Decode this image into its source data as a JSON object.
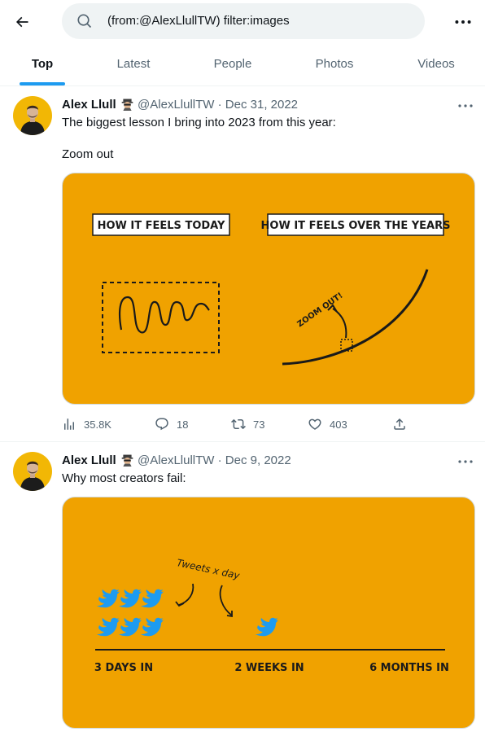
{
  "search": {
    "query": "(from:@AlexLlullTW) filter:images"
  },
  "tabs": [
    {
      "label": "Top",
      "active": true
    },
    {
      "label": "Latest",
      "active": false
    },
    {
      "label": "People",
      "active": false
    },
    {
      "label": "Photos",
      "active": false
    },
    {
      "label": "Videos",
      "active": false
    }
  ],
  "tweets": [
    {
      "name": "Alex Llull",
      "name_emoji": "spy-emoji",
      "handle": "@AlexLlullTW",
      "separator": "·",
      "date": "Dec 31, 2022",
      "text_lines": [
        "The biggest lesson I bring into 2023 from this year:",
        "Zoom out"
      ],
      "media": {
        "left_label": "HOW IT FEELS TODAY",
        "right_label": "HOW IT FEELS OVER THE YEARS",
        "annotation": "ZOOM OUT!"
      },
      "stats": {
        "views": "35.8K",
        "replies": "18",
        "retweets": "73",
        "likes": "403"
      }
    },
    {
      "name": "Alex Llull",
      "name_emoji": "spy-emoji",
      "handle": "@AlexLlullTW",
      "separator": "·",
      "date": "Dec 9, 2022",
      "text_lines": [
        "Why most creators fail:"
      ],
      "media": {
        "annotation": "Tweets x day",
        "milestones": [
          "3 DAYS IN",
          "2 WEEKS IN",
          "6 MONTHS IN"
        ]
      }
    }
  ],
  "colors": {
    "accent": "#1d9bf0",
    "media_bg": "#f0a200",
    "muted": "#536471",
    "twitter_bird": "#1d9bf0"
  }
}
